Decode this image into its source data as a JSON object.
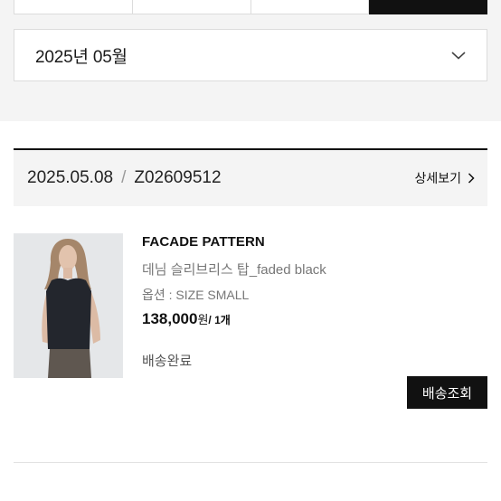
{
  "month_filter": {
    "selected": "2025년 05월"
  },
  "order": {
    "date": "2025.05.08",
    "separator": "/",
    "order_number": "Z02609512",
    "detail_link": "상세보기"
  },
  "product": {
    "brand": "FACADE PATTERN",
    "name": "데님 슬리브리스 탑_faded black",
    "option": "옵션 : SIZE SMALL",
    "price": "138,000",
    "currency": "원",
    "quantity": "/ 1개",
    "status": "배송완료",
    "track_button": "배송조회"
  },
  "colors": {
    "page_bg": "#ffffff",
    "panel_bg": "#f4f4f4",
    "primary": "#111111",
    "muted_text": "#777777"
  }
}
